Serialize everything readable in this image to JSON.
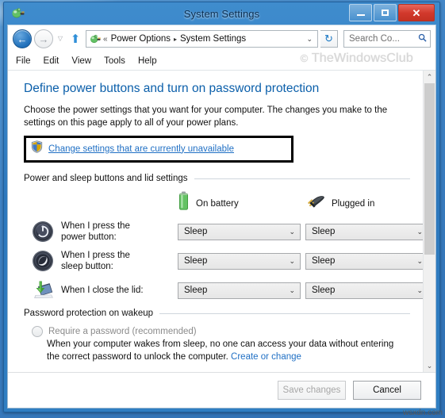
{
  "window": {
    "title": "System Settings",
    "icon": "power-options-icon",
    "minimize_label": "–",
    "maximize_label": "□",
    "close_label": "✕"
  },
  "navbar": {
    "back_label": "←",
    "forward_label": "→",
    "history_label": "▽",
    "up_label": "⬆",
    "address_icon": "power-options-icon",
    "chevrons": "«",
    "breadcrumbs": [
      "Power Options",
      "System Settings"
    ],
    "separator": "▸",
    "address_caret": "⌄",
    "refresh_label": "↻",
    "search_placeholder": "Search Co...",
    "search_icon": "search-icon"
  },
  "menubar": {
    "items": [
      "File",
      "Edit",
      "View",
      "Tools",
      "Help"
    ],
    "watermark_copyright": "©",
    "watermark_text": "TheWindowsClub"
  },
  "page": {
    "heading": "Define power buttons and turn on password protection",
    "description": "Choose the power settings that you want for your computer. The changes you make to the settings on this page apply to all of your power plans.",
    "admin_link": "Change settings that are currently unavailable",
    "admin_link_icon": "uac-shield-icon",
    "highlight_color": "#000000"
  },
  "power_section": {
    "title": "Power and sleep buttons and lid settings",
    "columns": [
      {
        "label": "On battery",
        "icon": "battery-icon"
      },
      {
        "label": "Plugged in",
        "icon": "power-plug-icon"
      }
    ],
    "rows": [
      {
        "icon": "power-button-icon",
        "label_line1": "When I press the",
        "label_line2": "power button:",
        "on_battery": "Sleep",
        "plugged_in": "Sleep"
      },
      {
        "icon": "sleep-moon-icon",
        "label_line1": "When I press the",
        "label_line2": "sleep button:",
        "on_battery": "Sleep",
        "plugged_in": "Sleep"
      },
      {
        "icon": "close-lid-icon",
        "label_line1": "When I close the lid:",
        "label_line2": "",
        "on_battery": "Sleep",
        "plugged_in": "Sleep"
      }
    ],
    "combo_caret": "⌄"
  },
  "password_section": {
    "title": "Password protection on wakeup",
    "radio_label": "Require a password (recommended)",
    "radio_checked": false,
    "description_line1": "When your computer wakes from sleep, no one can access your data without",
    "description_line2": "entering the correct password to unlock the computer.",
    "description_link": "Create or change"
  },
  "scrollbar": {
    "up_label": "⌃",
    "down_label": "⌄",
    "thumb_position_percent": 0,
    "thumb_size_percent": 62
  },
  "buttons": {
    "save_label": "Save changes",
    "save_enabled": false,
    "cancel_label": "Cancel",
    "cancel_enabled": true
  },
  "corner_watermark": "wsxdn.com"
}
